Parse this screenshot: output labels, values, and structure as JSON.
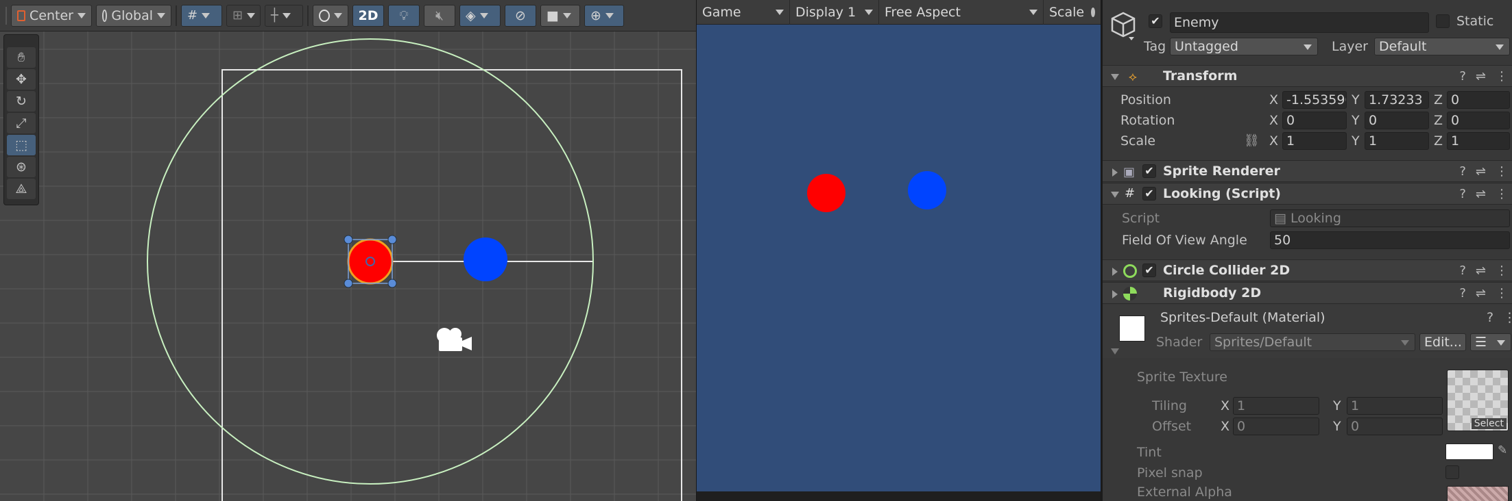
{
  "scene_toolbar": {
    "pivot_label": "Center",
    "space_label": "Global",
    "mode_2d_label": "2D"
  },
  "game_toolbar": {
    "tab_label": "Game",
    "display_label": "Display 1",
    "aspect_label": "Free Aspect",
    "scale_label": "Scale"
  },
  "inspector": {
    "object_name": "Enemy",
    "static_label": "Static",
    "tag_label": "Tag",
    "tag_value": "Untagged",
    "layer_label": "Layer",
    "layer_value": "Default",
    "transform": {
      "title": "Transform",
      "position_label": "Position",
      "rotation_label": "Rotation",
      "scale_label": "Scale",
      "axis_x": "X",
      "axis_y": "Y",
      "axis_z": "Z",
      "position": {
        "x": "-1.553596",
        "y": "1.73233",
        "z": "0"
      },
      "rotation": {
        "x": "0",
        "y": "0",
        "z": "0"
      },
      "scale": {
        "x": "1",
        "y": "1",
        "z": "1"
      }
    },
    "sprite_renderer": {
      "title": "Sprite Renderer"
    },
    "looking": {
      "title": "Looking (Script)",
      "script_label": "Script",
      "script_value": "Looking",
      "fov_label": "Field Of View Angle",
      "fov_value": "50"
    },
    "circle_collider": {
      "title": "Circle Collider 2D"
    },
    "rigidbody": {
      "title": "Rigidbody 2D"
    },
    "material": {
      "title": "Sprites-Default (Material)",
      "shader_label": "Shader",
      "shader_value": "Sprites/Default",
      "edit_label": "Edit...",
      "sprite_texture_label": "Sprite Texture",
      "tiling_label": "Tiling",
      "offset_label": "Offset",
      "tiling": {
        "x": "1",
        "y": "1"
      },
      "offset": {
        "x": "0",
        "y": "0"
      },
      "select_label": "Select",
      "tint_label": "Tint",
      "pixel_snap_label": "Pixel snap",
      "external_alpha_label": "External Alpha"
    }
  },
  "colors": {
    "enemy": "#ff0000",
    "target": "#0044ff",
    "game_bg": "#314d79",
    "scene_bg": "#464646",
    "fov_circle": "#c8f0c0"
  }
}
